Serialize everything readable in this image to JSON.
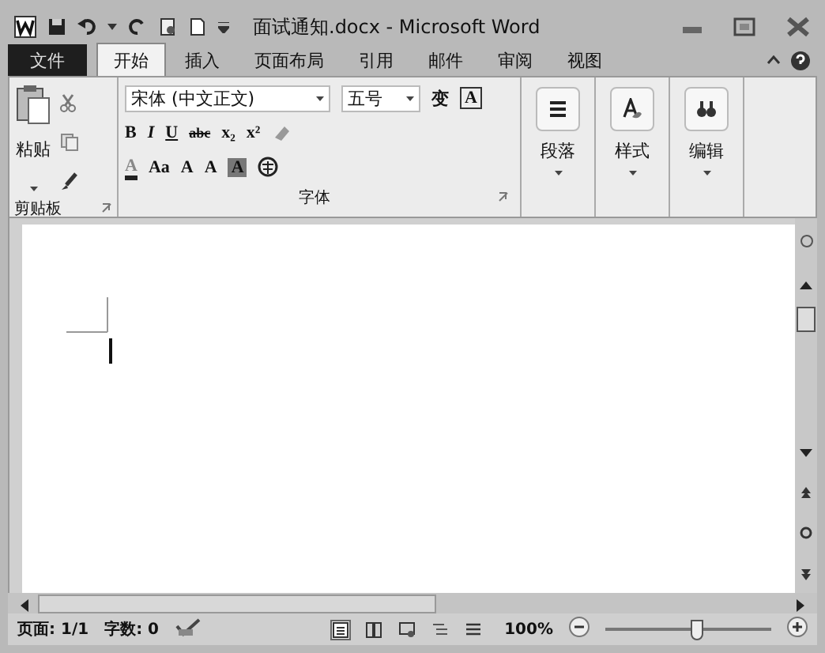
{
  "window": {
    "title": "面试通知.docx - Microsoft Word"
  },
  "tabs": [
    {
      "label": "文件",
      "selected": false,
      "kind": "file"
    },
    {
      "label": "开始",
      "selected": true,
      "kind": "tab"
    },
    {
      "label": "插入",
      "selected": false,
      "kind": "tab"
    },
    {
      "label": "页面布局",
      "selected": false,
      "kind": "tab"
    },
    {
      "label": "引用",
      "selected": false,
      "kind": "tab"
    },
    {
      "label": "邮件",
      "selected": false,
      "kind": "tab"
    },
    {
      "label": "审阅",
      "selected": false,
      "kind": "tab"
    },
    {
      "label": "视图",
      "selected": false,
      "kind": "tab"
    }
  ],
  "clipboard": {
    "paste": "粘贴",
    "group": "剪贴板"
  },
  "font": {
    "name": "宋体 (中文正文)",
    "size": "五号",
    "group": "字体",
    "row1": [
      "变",
      "A"
    ],
    "row2": [
      {
        "label": "B",
        "kind": "bold"
      },
      {
        "label": "I",
        "kind": "italic"
      },
      {
        "label": "U",
        "kind": "underline"
      },
      {
        "label": "abc",
        "kind": "strike"
      },
      {
        "label": "x₂",
        "kind": "plain"
      },
      {
        "label": "x²",
        "kind": "plain"
      }
    ],
    "row3": [
      {
        "label": "A",
        "kind": "color"
      },
      {
        "label": "Aa",
        "kind": "plain"
      },
      {
        "label": "A",
        "kind": "plain"
      },
      {
        "label": "A",
        "kind": "plain"
      },
      {
        "label": "A",
        "kind": "shaded"
      }
    ]
  },
  "big_buttons": [
    {
      "label": "段落",
      "kind": "paragraph"
    },
    {
      "label": "样式",
      "kind": "styles"
    },
    {
      "label": "编辑",
      "kind": "editing"
    }
  ],
  "status_bar": {
    "page": "页面: 1/1",
    "words": "字数: 0",
    "zoom": "100%",
    "level": 0.55
  }
}
